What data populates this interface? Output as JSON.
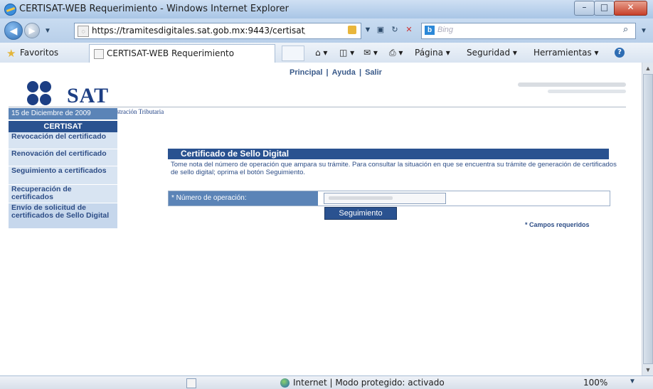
{
  "window": {
    "title": "CERTISAT-WEB Requerimiento - Windows Internet Explorer",
    "min_label": "–",
    "max_label": "□",
    "close_label": "✕"
  },
  "address": {
    "url": "https://tramitesdigitales.sat.gob.mx:9443/certisat/requ",
    "search_placeholder": "Bing",
    "search_logo": "b"
  },
  "favorites": {
    "label": "Favoritos",
    "tab_title": "CERTISAT-WEB Requerimiento"
  },
  "commands": {
    "pagina": "Página ▾",
    "seguridad": "Seguridad ▾",
    "herramientas": "Herramientas ▾",
    "help": "?"
  },
  "page": {
    "topnav": [
      "Principal",
      "Ayuda",
      "Salir"
    ],
    "separator": "|",
    "logo": {
      "name": "SAT",
      "subtitle": "Servicio de Administración Tributaria"
    },
    "date": "15 de Diciembre de 2009",
    "sidebar_title": "CERTISAT",
    "sidebar_items": [
      "Revocación del certificado",
      "Renovación del certificado",
      "Seguimiento a certificados",
      "Recuperación de certificados",
      "Envío de solicitud de certificados de Sello Digital"
    ],
    "section_title": "Certificado de Sello Digital",
    "description": "Tome nota del número de operación que ampara su trámite. Para consultar la situación en que se encuentra su trámite de generación de certificados de sello digital; oprima el botón Seguimiento.",
    "field_label": "* Número de operación:",
    "button_label": "Seguimiento",
    "required_note": "* Campos requeridos"
  },
  "statusbar": {
    "zone": "Internet | Modo protegido: activado",
    "zoom": "100%"
  },
  "colors": {
    "brand_blue": "#2a5290",
    "sidebar_bg": "#d8e4f2",
    "label_blue": "#5b84b7"
  }
}
